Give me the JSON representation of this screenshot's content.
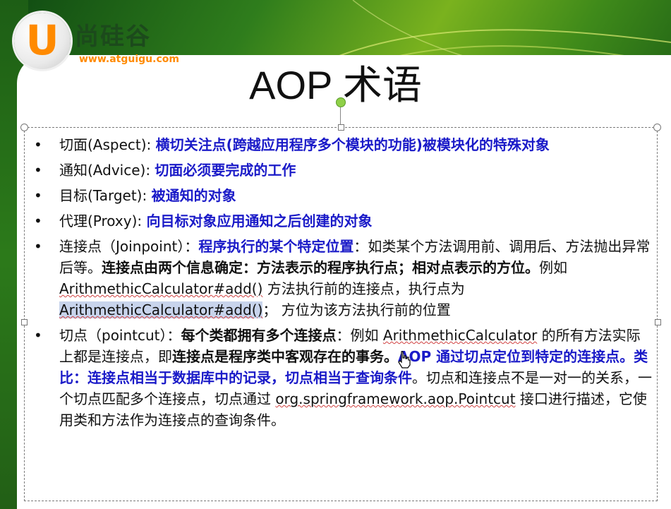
{
  "logo": {
    "letter": "U",
    "name": "尚硅谷",
    "url": "www.atguigu.com"
  },
  "slide": {
    "title": "AOP 术语"
  },
  "items": [
    {
      "term": "切面(Aspect): ",
      "desc": "横切关注点(跨越应用程序多个模块的功能)被模块化的特殊对象"
    },
    {
      "term": "通知(Advice): ",
      "desc": "切面必须要完成的工作"
    },
    {
      "term": "目标(Target): ",
      "desc": "被通知的对象"
    },
    {
      "term": "代理(Proxy): ",
      "desc": "向目标对象应用通知之后创建的对象"
    },
    {
      "term": "连接点（Joinpoint）：",
      "p1": "程序执行的某个特定位置",
      "p2": "：如类某个方法调用前、调用后、方法抛出异常后等。",
      "p3": "连接点由两个信息确定：方法表示的程序执行点；相对点表示的方位。",
      "p4": "例如 ",
      "p5": "ArithmethicCalculator#add()",
      "p6": " 方法执行前的连接点，执行点为 ",
      "p7": "ArithmethicCalculator#add()",
      "p8": "； 方位为该方法执行前的位置"
    },
    {
      "term": "切点（pointcut）：",
      "p1": "每个类都拥有多个连接点",
      "p2": "：例如 ",
      "p3": "ArithmethicCalculator",
      "p4": " 的所有方法实际上都是连接点，即",
      "p5": "连接点是程序类中客观存在的事务。",
      "p6": "AOP 通过切点定位到特定的连接点。类比：连接点相当于数据库中的记录，切点相当于查询条件",
      "p7": "。切点和连接点不是一对一的关系，一个切点匹配多个连接点，切点通过 ",
      "p8": "org.springframework.aop.Pointcut",
      "p9": " 接口进行描述，它使用类和方法作为连接点的查询条件。"
    }
  ]
}
